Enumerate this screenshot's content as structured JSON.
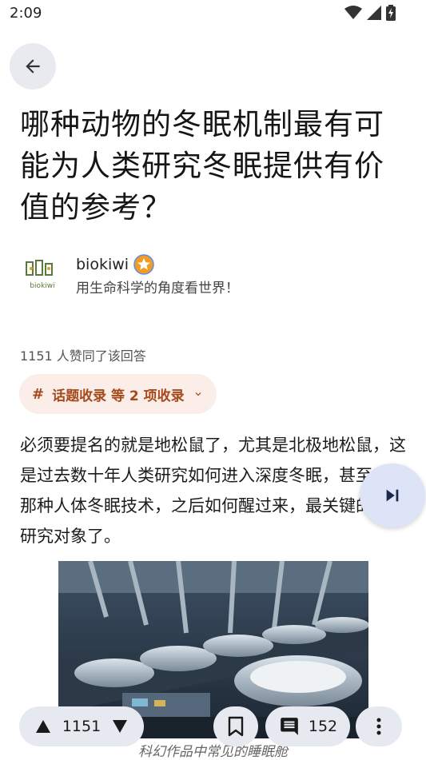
{
  "status_bar": {
    "time": "2:09",
    "icons": [
      "wifi-icon",
      "signal-icon",
      "battery-charging-icon"
    ]
  },
  "question": {
    "title": "哪种动物的冬眠机制最有可能为人类研究冬眠提供有价值的参考？"
  },
  "author": {
    "name": "biokiwi",
    "bio": "用生命科学的角度看世界！",
    "avatar_text": "biokiwi",
    "badge_icon": "verified-star-badge-icon"
  },
  "answer": {
    "likes_text": "1151 人赞同了该回答",
    "collection_label": "话题收录 等 2 项收录",
    "collection_icon": "hashtag-icon",
    "body": "必须要提名的就是地松鼠了，尤其是北极地松鼠，这是过去数十年人类研究如何进入深度冬眠，甚至三体那种人体冬眠技术，之后如何醒过来，最关键的一个研究对象了。",
    "image_caption": "科幻作品中常见的睡眠舱"
  },
  "bottom_bar": {
    "vote_count": "1151",
    "comment_count": "152"
  },
  "colors": {
    "chip_bg": "#fbeee8",
    "chip_text": "#a44a1c",
    "fab_bg": "#dde4f8",
    "pill_bg": "#e6e9ef"
  }
}
